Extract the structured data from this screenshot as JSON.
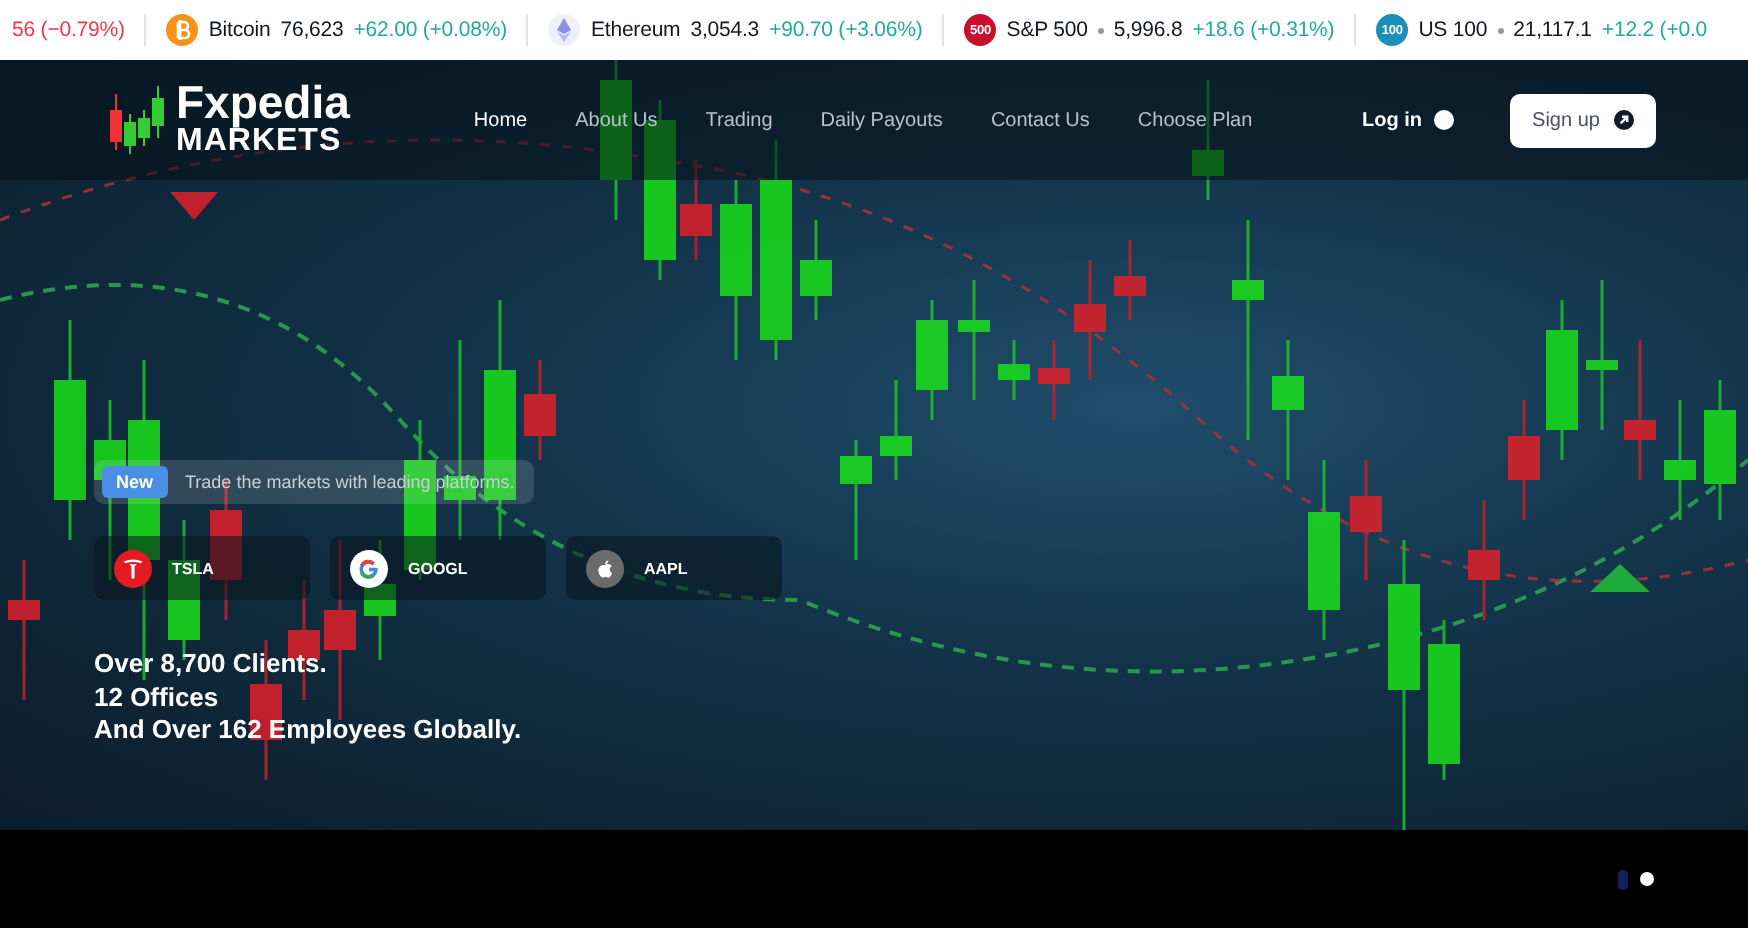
{
  "ticker": [
    {
      "kind": "partial",
      "change": "56 (−0.79%)",
      "color": "#f23645"
    },
    {
      "kind": "bitcoin",
      "name": "Bitcoin",
      "price": "76,623",
      "change": "+62.00 (+0.08%)",
      "color": "#22ab94"
    },
    {
      "kind": "ethereum",
      "name": "Ethereum",
      "price": "3,054.3",
      "change": "+90.70 (+3.06%)",
      "color": "#22ab94"
    },
    {
      "kind": "badge",
      "badge": {
        "text": "500",
        "color": "#c8102e"
      },
      "name": "S&P 500",
      "price": "5,996.8",
      "change": "+18.6 (+0.31%)",
      "color": "#22ab94"
    },
    {
      "kind": "badge",
      "badge": {
        "text": "100",
        "color": "#1a8fb8"
      },
      "name": "US 100",
      "price": "21,117.1",
      "change": "+12.2 (+0.0",
      "color": "#22ab94"
    }
  ],
  "logo": {
    "line1": "Fxpedia",
    "line2": "MARKETS"
  },
  "nav": [
    {
      "label": "Home",
      "selected": true
    },
    {
      "label": "About Us",
      "selected": false
    },
    {
      "label": "Trading",
      "selected": false
    },
    {
      "label": "Daily Payouts",
      "selected": false
    },
    {
      "label": "Contact Us",
      "selected": false
    },
    {
      "label": "Choose Plan",
      "selected": false
    }
  ],
  "login": "Log in",
  "signup": "Sign up",
  "announcement": {
    "badge": "New",
    "text": "Trade the markets with leading platforms."
  },
  "stocks": [
    {
      "kind": "tesla",
      "label": "TSLA"
    },
    {
      "kind": "google",
      "label": "GOOGL"
    },
    {
      "kind": "apple",
      "label": "AAPL"
    }
  ],
  "headline": [
    "Over 8,700 Clients.",
    "12 Offices",
    "And Over 162 Employees Globally."
  ],
  "carousel": [
    {
      "selected": false
    },
    {
      "selected": true
    }
  ]
}
